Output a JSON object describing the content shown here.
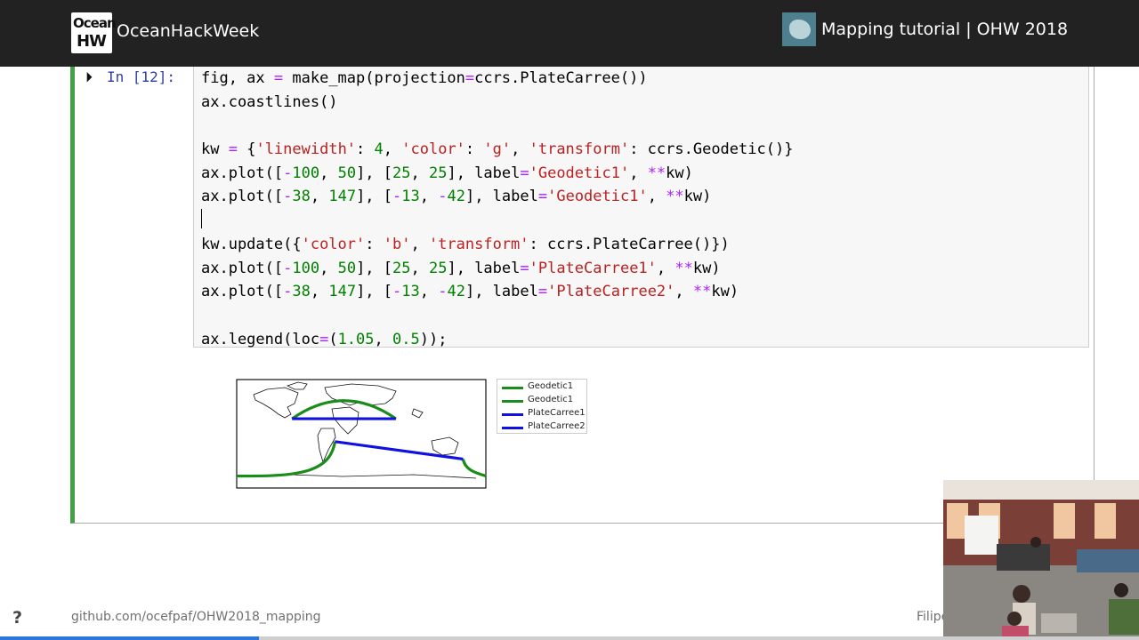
{
  "header": {
    "logo_line1": "Ocean",
    "logo_line2": "HW",
    "brand": "OceanHackWeek",
    "tutorial_title": "Mapping tutorial | OHW 2018"
  },
  "cell": {
    "prompt": "In [12]:",
    "code_lines": [
      [
        {
          "t": "fig, ax "
        },
        {
          "t": "=",
          "c": "op"
        },
        {
          "t": " make_map(projection"
        },
        {
          "t": "=",
          "c": "op"
        },
        {
          "t": "ccrs.PlateCarree())"
        }
      ],
      [
        {
          "t": "ax.coastlines()"
        }
      ],
      [
        {
          "t": ""
        }
      ],
      [
        {
          "t": "kw "
        },
        {
          "t": "=",
          "c": "op"
        },
        {
          "t": " {"
        },
        {
          "t": "'linewidth'",
          "c": "str"
        },
        {
          "t": ": "
        },
        {
          "t": "4",
          "c": "num"
        },
        {
          "t": ", "
        },
        {
          "t": "'color'",
          "c": "str"
        },
        {
          "t": ": "
        },
        {
          "t": "'g'",
          "c": "str"
        },
        {
          "t": ", "
        },
        {
          "t": "'transform'",
          "c": "str"
        },
        {
          "t": ": ccrs.Geodetic()}"
        }
      ],
      [
        {
          "t": "ax.plot(["
        },
        {
          "t": "-",
          "c": "op"
        },
        {
          "t": "100",
          "c": "num"
        },
        {
          "t": ", "
        },
        {
          "t": "50",
          "c": "num"
        },
        {
          "t": "], ["
        },
        {
          "t": "25",
          "c": "num"
        },
        {
          "t": ", "
        },
        {
          "t": "25",
          "c": "num"
        },
        {
          "t": "], label"
        },
        {
          "t": "=",
          "c": "op"
        },
        {
          "t": "'Geodetic1'",
          "c": "str"
        },
        {
          "t": ", "
        },
        {
          "t": "**",
          "c": "op"
        },
        {
          "t": "kw)"
        }
      ],
      [
        {
          "t": "ax.plot(["
        },
        {
          "t": "-",
          "c": "op"
        },
        {
          "t": "38",
          "c": "num"
        },
        {
          "t": ", "
        },
        {
          "t": "147",
          "c": "num"
        },
        {
          "t": "], ["
        },
        {
          "t": "-",
          "c": "op"
        },
        {
          "t": "13",
          "c": "num"
        },
        {
          "t": ", "
        },
        {
          "t": "-",
          "c": "op"
        },
        {
          "t": "42",
          "c": "num"
        },
        {
          "t": "], label"
        },
        {
          "t": "=",
          "c": "op"
        },
        {
          "t": "'Geodetic1'",
          "c": "str"
        },
        {
          "t": ", "
        },
        {
          "t": "**",
          "c": "op"
        },
        {
          "t": "kw)"
        }
      ],
      [
        {
          "t": ""
        }
      ],
      [
        {
          "t": "kw.update({"
        },
        {
          "t": "'color'",
          "c": "str"
        },
        {
          "t": ": "
        },
        {
          "t": "'b'",
          "c": "str"
        },
        {
          "t": ", "
        },
        {
          "t": "'transform'",
          "c": "str"
        },
        {
          "t": ": ccrs.PlateCarree()})"
        }
      ],
      [
        {
          "t": "ax.plot(["
        },
        {
          "t": "-",
          "c": "op"
        },
        {
          "t": "100",
          "c": "num"
        },
        {
          "t": ", "
        },
        {
          "t": "50",
          "c": "num"
        },
        {
          "t": "], ["
        },
        {
          "t": "25",
          "c": "num"
        },
        {
          "t": ", "
        },
        {
          "t": "25",
          "c": "num"
        },
        {
          "t": "], label"
        },
        {
          "t": "=",
          "c": "op"
        },
        {
          "t": "'PlateCarree1'",
          "c": "str"
        },
        {
          "t": ", "
        },
        {
          "t": "**",
          "c": "op"
        },
        {
          "t": "kw)"
        }
      ],
      [
        {
          "t": "ax.plot(["
        },
        {
          "t": "-",
          "c": "op"
        },
        {
          "t": "38",
          "c": "num"
        },
        {
          "t": ", "
        },
        {
          "t": "147",
          "c": "num"
        },
        {
          "t": "], ["
        },
        {
          "t": "-",
          "c": "op"
        },
        {
          "t": "13",
          "c": "num"
        },
        {
          "t": ", "
        },
        {
          "t": "-",
          "c": "op"
        },
        {
          "t": "42",
          "c": "num"
        },
        {
          "t": "], label"
        },
        {
          "t": "=",
          "c": "op"
        },
        {
          "t": "'PlateCarree2'",
          "c": "str"
        },
        {
          "t": ", "
        },
        {
          "t": "**",
          "c": "op"
        },
        {
          "t": "kw)"
        }
      ],
      [
        {
          "t": ""
        }
      ],
      [
        {
          "t": "ax.legend(loc"
        },
        {
          "t": "=",
          "c": "op"
        },
        {
          "t": "("
        },
        {
          "t": "1.05",
          "c": "num"
        },
        {
          "t": ", "
        },
        {
          "t": "0.5",
          "c": "num"
        },
        {
          "t": "));"
        }
      ]
    ]
  },
  "output": {
    "legend": [
      {
        "label": "Geodetic1",
        "color": "#1a8c1a"
      },
      {
        "label": "Geodetic1",
        "color": "#1a8c1a"
      },
      {
        "label": "PlateCarree1",
        "color": "#1010e0"
      },
      {
        "label": "PlateCarree2",
        "color": "#1010e0"
      }
    ]
  },
  "footer": {
    "help": "?",
    "link": "github.com/ocefpaf/OHW2018_mapping",
    "presenter": "Filipe"
  },
  "progress": {
    "fraction": 0.227
  },
  "colors": {
    "accent_green": "#43a047",
    "prompt_blue": "#303f9f",
    "geodetic": "#1a8c1a",
    "platecarree": "#1010e0"
  }
}
